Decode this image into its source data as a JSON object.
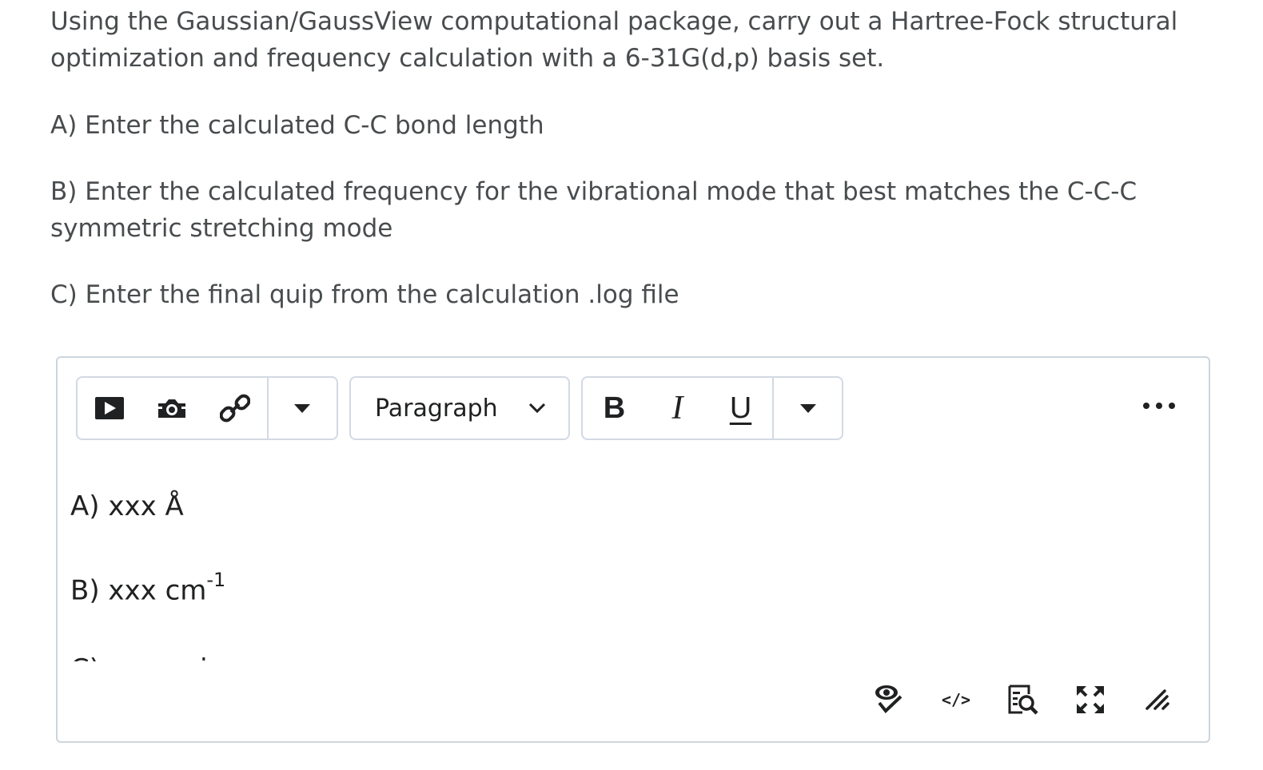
{
  "question": {
    "intro": "Using the Gaussian/GaussView computational package, carry out a Hartree-Fock structural optimization and frequency calculation with a 6-31G(d,p) basis set.",
    "part_a": "A) Enter the calculated C-C bond length",
    "part_b": "B) Enter the calculated frequency for the vibrational mode that best matches the C-C-C symmetric stretching mode",
    "part_c": "C) Enter the final quip from the calculation .log file"
  },
  "editor": {
    "toolbar": {
      "icons": [
        "video-icon",
        "camera-icon",
        "link-icon",
        "caret-down-icon"
      ],
      "format_select": "Paragraph",
      "bold_label": "B",
      "italic_label": "I",
      "underline_label": "U"
    },
    "content": {
      "line_a": "A) xxx Å",
      "line_b": "B) xxx cm",
      "line_b_sup": "-1",
      "line_c": "C) xxx quip"
    },
    "bottom_bar": {
      "source_code_label": "</>",
      "icons": [
        "accessibility-check-icon",
        "source-code-icon",
        "preview-icon",
        "fullscreen-icon",
        "resize-handle-icon"
      ]
    }
  }
}
